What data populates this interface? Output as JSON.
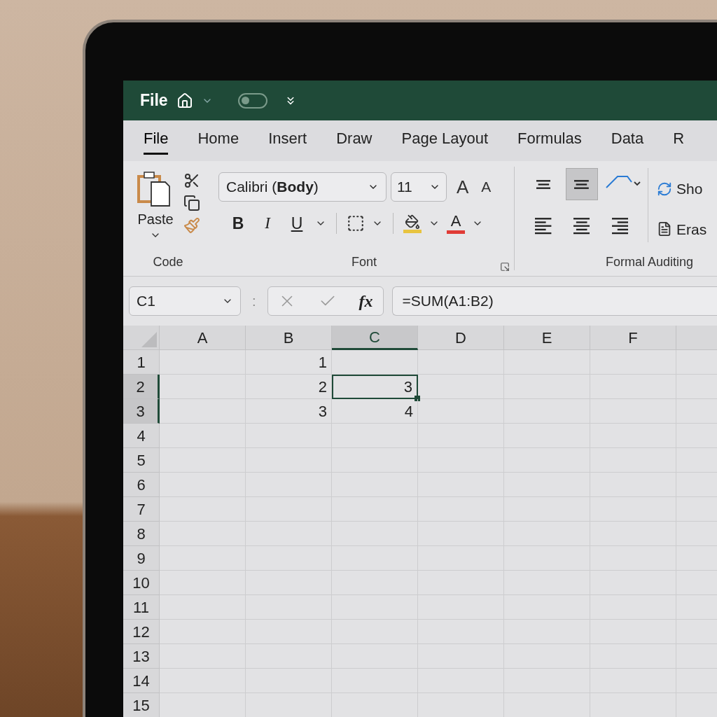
{
  "title_bar": {
    "label": "File",
    "autosave_toggle": {
      "on": false
    }
  },
  "tabs": [
    {
      "label": "File",
      "selected": true
    },
    {
      "label": "Home",
      "selected": false
    },
    {
      "label": "Insert",
      "selected": false
    },
    {
      "label": "Draw",
      "selected": false
    },
    {
      "label": "Page Layout",
      "selected": false
    },
    {
      "label": "Formulas",
      "selected": false
    },
    {
      "label": "Data",
      "selected": false
    },
    {
      "label": "R",
      "selected": false
    }
  ],
  "ribbon": {
    "paste_label": "Paste",
    "font_name": "Calibri (**Body**)",
    "font_size": "11",
    "grow_label": "A",
    "shrink_label": "A",
    "format_buttons": [
      {
        "kind": "bold",
        "label": "B"
      },
      {
        "kind": "italic",
        "label": "I"
      },
      {
        "kind": "underline",
        "label": "U"
      }
    ],
    "font_color_label": "A",
    "align_buttons": [
      {
        "kind": "top",
        "selected": false
      },
      {
        "kind": "middle",
        "selected": true
      },
      {
        "kind": "left",
        "selected": false
      },
      {
        "kind": "center",
        "selected": false
      },
      {
        "kind": "right",
        "selected": false
      }
    ],
    "side_buttons": [
      "Sho",
      "Eras"
    ],
    "groups": [
      "Code",
      "Font",
      "Formal Auditing"
    ]
  },
  "formula_bar": {
    "name_box": "C1",
    "separator": ":",
    "fx": "fx",
    "formula": "=SUM(A1:B2)"
  },
  "sheet": {
    "columns": [
      {
        "label": "A",
        "selected": false
      },
      {
        "label": "B",
        "selected": false
      },
      {
        "label": "C",
        "selected": true
      },
      {
        "label": "D",
        "selected": false
      },
      {
        "label": "E",
        "selected": false
      },
      {
        "label": "F",
        "selected": false
      }
    ],
    "rows": [
      {
        "label": "1",
        "selected": false,
        "cells": [
          {
            "selected": false
          },
          {
            "value": "1",
            "selected": false
          },
          {
            "selected": false
          },
          {
            "selected": false
          },
          {
            "selected": false
          },
          {
            "selected": false
          }
        ]
      },
      {
        "label": "2",
        "selected": true,
        "cells": [
          {
            "selected": false
          },
          {
            "value": "2",
            "selected": false
          },
          {
            "value": "3",
            "selected": true
          },
          {
            "selected": false
          },
          {
            "selected": false
          },
          {
            "selected": false
          }
        ]
      },
      {
        "label": "3",
        "selected": true,
        "cells": [
          {
            "selected": false
          },
          {
            "value": "3",
            "selected": false
          },
          {
            "value": "4",
            "selected": false
          },
          {
            "selected": false
          },
          {
            "selected": false
          },
          {
            "selected": false
          }
        ]
      },
      {
        "label": "4",
        "selected": false
      },
      {
        "label": "5",
        "selected": false
      },
      {
        "label": "6",
        "selected": false
      },
      {
        "label": "7",
        "selected": false
      },
      {
        "label": "8",
        "selected": false
      },
      {
        "label": "9",
        "selected": false
      },
      {
        "label": "10",
        "selected": false
      },
      {
        "label": "11",
        "selected": false
      },
      {
        "label": "12",
        "selected": false
      },
      {
        "label": "13",
        "selected": false
      },
      {
        "label": "14",
        "selected": false
      },
      {
        "label": "15",
        "selected": false
      }
    ]
  }
}
